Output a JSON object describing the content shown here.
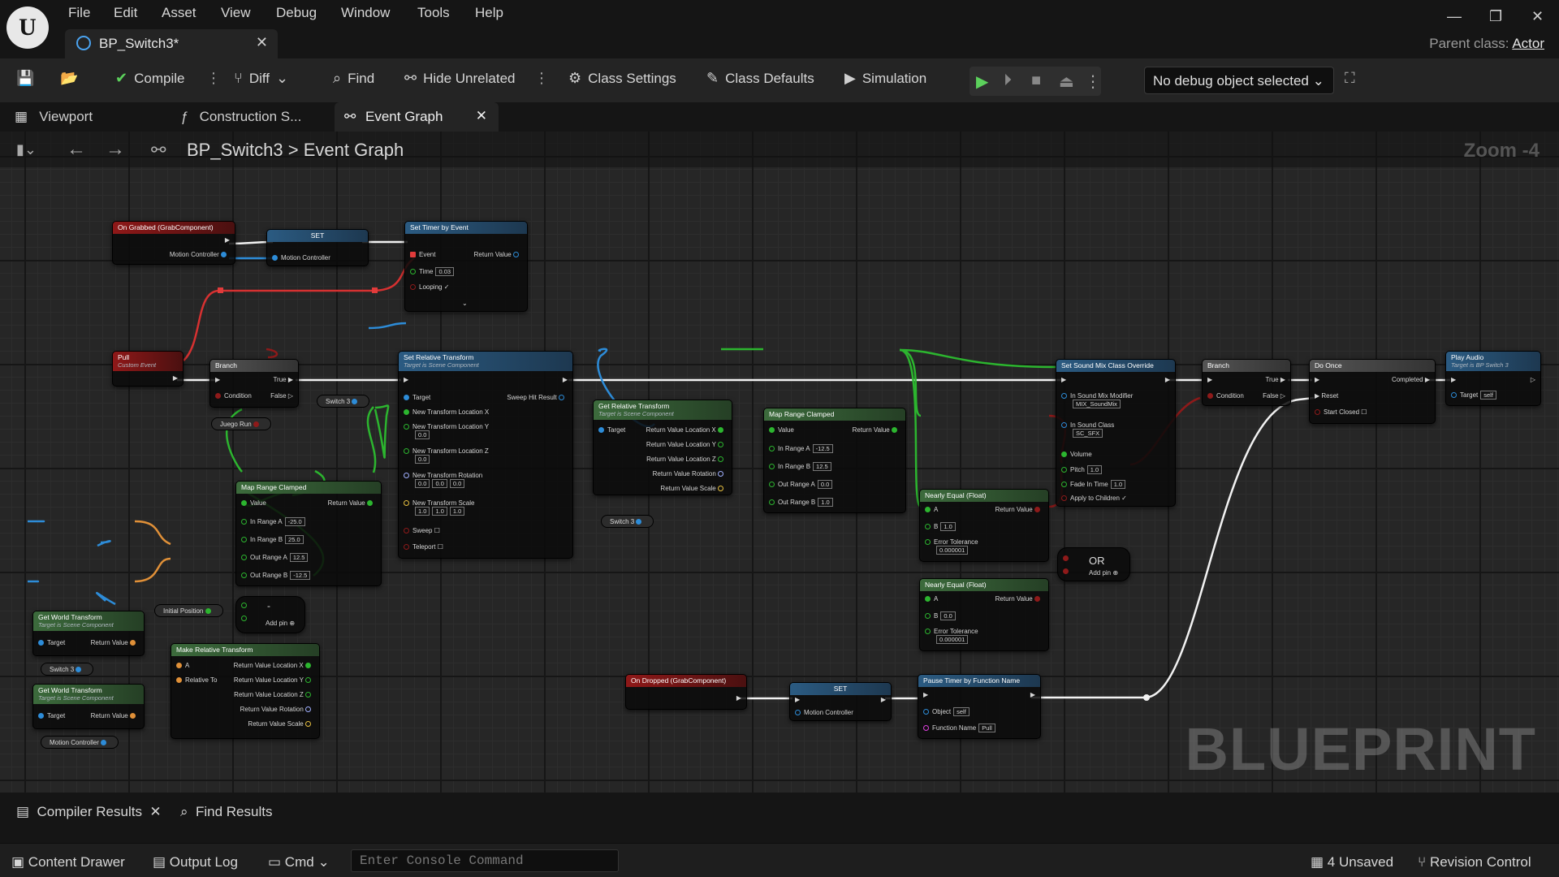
{
  "menu": [
    "File",
    "Edit",
    "Asset",
    "View",
    "Debug",
    "Window",
    "Tools",
    "Help"
  ],
  "document_tab": "BP_Switch3*",
  "parent_class_label": "Parent class:",
  "parent_class_value": "Actor",
  "toolbar": {
    "compile": "Compile",
    "diff": "Diff",
    "find": "Find",
    "hide_unrelated": "Hide Unrelated",
    "class_settings": "Class Settings",
    "class_defaults": "Class Defaults",
    "simulation": "Simulation",
    "debug_object": "No debug object selected"
  },
  "graph_tabs": {
    "viewport": "Viewport",
    "construction": "Construction S...",
    "event_graph": "Event Graph"
  },
  "breadcrumb": {
    "blueprint": "BP_Switch3",
    "graph": "Event Graph"
  },
  "zoom": "Zoom -4",
  "watermark": "BLUEPRINT",
  "bottom_tabs": {
    "compiler": "Compiler Results",
    "find": "Find Results"
  },
  "status": {
    "content_drawer": "Content Drawer",
    "output_log": "Output Log",
    "cmd": "Cmd",
    "console_placeholder": "Enter Console Command",
    "unsaved": "4 Unsaved",
    "revision": "Revision Control"
  },
  "colors": {
    "exec": "#ffffff",
    "object": "#2d8cd8",
    "float": "#35c33a",
    "event": "#e23b3b",
    "vector": "#e8c040",
    "rotator": "#a0b0ff"
  },
  "nodes": {
    "on_grabbed": {
      "title": "On Grabbed (GrabComponent)",
      "pin": "Motion Controller"
    },
    "set1": {
      "title": "SET",
      "pin": "Motion Controller"
    },
    "set_timer": {
      "title": "Set Timer by Event",
      "event": "Event",
      "return": "Return Value",
      "time": "Time",
      "time_val": "0.03",
      "looping": "Looping"
    },
    "pull": {
      "title": "Pull",
      "sub": "Custom Event"
    },
    "branch1": {
      "title": "Branch",
      "true": "True",
      "false": "False",
      "condition": "Condition"
    },
    "juego_run": "Juego Run",
    "switch3_a": "Switch 3",
    "set_rel": {
      "title": "Set Relative Transform",
      "sub": "Target is Scene Component",
      "target": "Target",
      "sweep_hit": "Sweep Hit Result",
      "loc_x": "New Transform Location X",
      "loc_y": "New Transform Location Y",
      "loc_y_val": "0.0",
      "loc_z": "New Transform Location Z",
      "loc_z_val": "0.0",
      "rot": "New Transform Rotation",
      "rot_x": "0.0",
      "rot_y": "0.0",
      "rot_z": "0.0",
      "scale": "New Transform Scale",
      "sc_x": "1.0",
      "sc_y": "1.0",
      "sc_z": "1.0",
      "sweep": "Sweep",
      "teleport": "Teleport"
    },
    "get_rel": {
      "title": "Get Relative Transform",
      "sub": "Target is Scene Component",
      "target": "Target",
      "rx": "Return Value Location X",
      "ry": "Return Value Location Y",
      "rz": "Return Value Location Z",
      "rr": "Return Value Rotation",
      "rs": "Return Value Scale"
    },
    "switch3_b": "Switch 3",
    "map1": {
      "title": "Map Range Clamped",
      "value": "Value",
      "return": "Return Value",
      "ina": "In Range A",
      "ina_v": "-25.0",
      "inb": "In Range B",
      "inb_v": "25.0",
      "outa": "Out Range A",
      "outa_v": "12.5",
      "outb": "Out Range B",
      "outb_v": "-12.5"
    },
    "map2": {
      "title": "Map Range Clamped",
      "value": "Value",
      "return": "Return Value",
      "ina": "In Range A",
      "ina_v": "-12.5",
      "inb": "In Range B",
      "inb_v": "12.5",
      "outa": "Out Range A",
      "outa_v": "0.0",
      "outb": "Out Range B",
      "outb_v": "1.0"
    },
    "near1": {
      "title": "Nearly Equal (Float)",
      "a": "A",
      "return": "Return Value",
      "b": "B",
      "b_v": "1.0",
      "tol": "Error Tolerance",
      "tol_v": "0.000001"
    },
    "near2": {
      "title": "Nearly Equal (Float)",
      "a": "A",
      "return": "Return Value",
      "b": "B",
      "b_v": "0.0",
      "tol": "Error Tolerance",
      "tol_v": "0.000001"
    },
    "or": {
      "title": "OR",
      "add": "Add pin"
    },
    "sound": {
      "title": "Set Sound Mix Class Override",
      "mix": "In Sound Mix Modifier",
      "mix_v": "MIX_SoundMix",
      "cls": "In Sound Class",
      "cls_v": "SC_SFX",
      "vol": "Volume",
      "pitch": "Pitch",
      "pitch_v": "1.0",
      "fade": "Fade In Time",
      "fade_v": "1.0",
      "children": "Apply to Children"
    },
    "branch2": {
      "title": "Branch",
      "true": "True",
      "false": "False",
      "condition": "Condition"
    },
    "do_once": {
      "title": "Do Once",
      "completed": "Completed",
      "reset": "Reset",
      "start_closed": "Start Closed"
    },
    "play_audio": {
      "title": "Play Audio",
      "sub": "Target is BP Switch 3",
      "target": "Target",
      "target_v": "self"
    },
    "initial_pos": "Initial Position",
    "minus": {
      "title": "-",
      "add": "Add pin"
    },
    "gwt1": {
      "title": "Get World Transform",
      "sub": "Target is Scene Component",
      "target": "Target",
      "return": "Return Value"
    },
    "switch3_c": "Switch 3",
    "gwt2": {
      "title": "Get World Transform",
      "sub": "Target is Scene Component",
      "target": "Target",
      "return": "Return Value"
    },
    "motion_ctrl": "Motion Controller",
    "make_rel": {
      "title": "Make Relative Transform",
      "a": "A",
      "rel": "Relative To",
      "rx": "Return Value Location X",
      "ry": "Return Value Location Y",
      "rz": "Return Value Location Z",
      "rr": "Return Value Rotation",
      "rs": "Return Value Scale"
    },
    "on_dropped": {
      "title": "On Dropped (GrabComponent)"
    },
    "set2": {
      "title": "SET",
      "pin": "Motion Controller"
    },
    "pause": {
      "title": "Pause Timer by Function Name",
      "object": "Object",
      "object_v": "self",
      "fname": "Function Name",
      "fname_v": "Pull"
    }
  }
}
